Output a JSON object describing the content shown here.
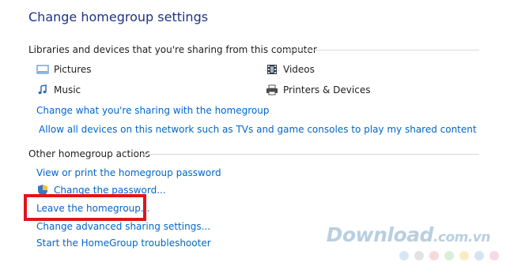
{
  "page": {
    "title": "Change homegroup settings"
  },
  "sharing": {
    "heading": "Libraries and devices that you're sharing from this computer",
    "items": [
      {
        "label": "Pictures",
        "icon": "pictures-icon"
      },
      {
        "label": "Videos",
        "icon": "videos-icon"
      },
      {
        "label": "Music",
        "icon": "music-icon"
      },
      {
        "label": "Printers & Devices",
        "icon": "printers-icon"
      }
    ],
    "change_link": "Change what you're sharing with the homegroup",
    "allow_link": "Allow all devices on this network such as TVs and game consoles to play my shared content"
  },
  "other": {
    "heading": "Other homegroup actions",
    "view_password": "View or print the homegroup password",
    "change_password": "Change the password...",
    "leave": "Leave the homegroup...",
    "advanced": "Change advanced sharing settings...",
    "troubleshooter": "Start the HomeGroup troubleshooter"
  },
  "watermark": {
    "brand": "Download",
    "domain": ".com.vn",
    "dot_colors": [
      "#d6e6f5",
      "#e3e3e3",
      "#f7d9d9",
      "#d9efd9",
      "#fbecc4",
      "#d6e3f3",
      "#f7d9e8"
    ]
  },
  "colors": {
    "title": "#1e3287",
    "link": "#0066cc",
    "highlight": "#e0141e"
  }
}
